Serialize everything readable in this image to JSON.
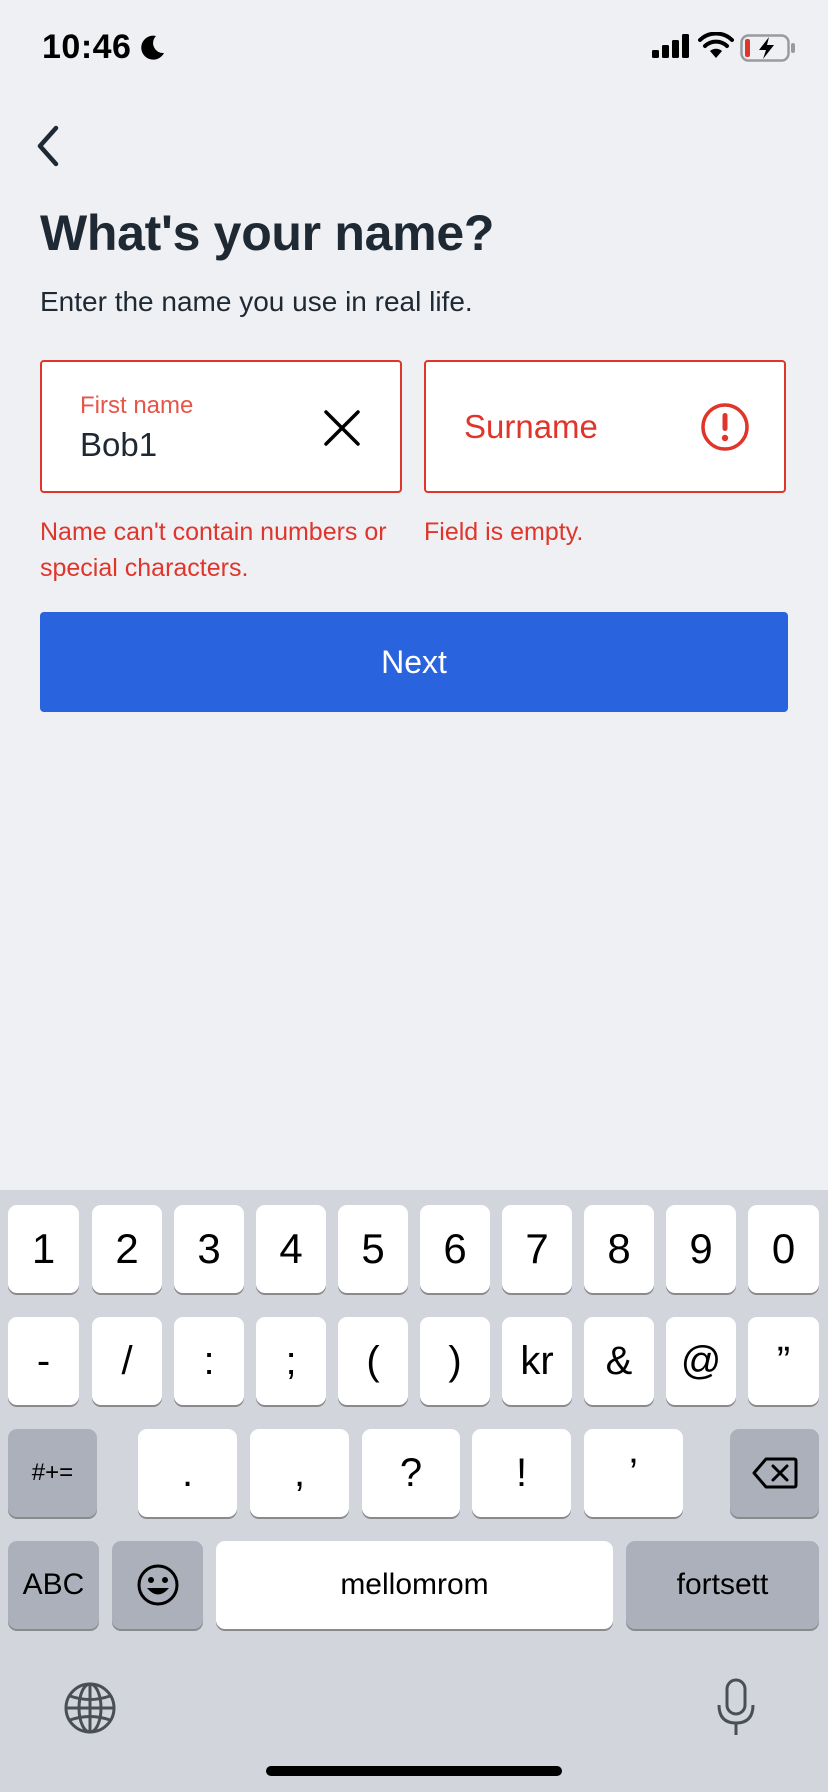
{
  "status_bar": {
    "time": "10:46"
  },
  "header": {
    "title": "What's your name?",
    "subtitle": "Enter the name you use in real life."
  },
  "form": {
    "first_name": {
      "label": "First name",
      "value": "Bob1",
      "error": "Name can't contain numbers or special characters."
    },
    "surname": {
      "placeholder": "Surname",
      "error": "Field is empty."
    },
    "next_label": "Next"
  },
  "colors": {
    "background": "#eef0f4",
    "error": "#e0352b",
    "primary": "#2a63de",
    "keyboard": "#d2d5db"
  },
  "keyboard": {
    "row1": [
      "1",
      "2",
      "3",
      "4",
      "5",
      "6",
      "7",
      "8",
      "9",
      "0"
    ],
    "row2": [
      "-",
      "/",
      ":",
      ";",
      "(",
      ")",
      "kr",
      "&",
      "@",
      "”"
    ],
    "row3": [
      ".",
      ",",
      "?",
      "!",
      "’"
    ],
    "symbols_key": "#+=",
    "abc_key": "ABC",
    "space_key": "mellomrom",
    "return_key": "fortsett",
    "icons": [
      "backspace-icon",
      "emoji-icon",
      "globe-icon",
      "microphone-icon"
    ]
  }
}
